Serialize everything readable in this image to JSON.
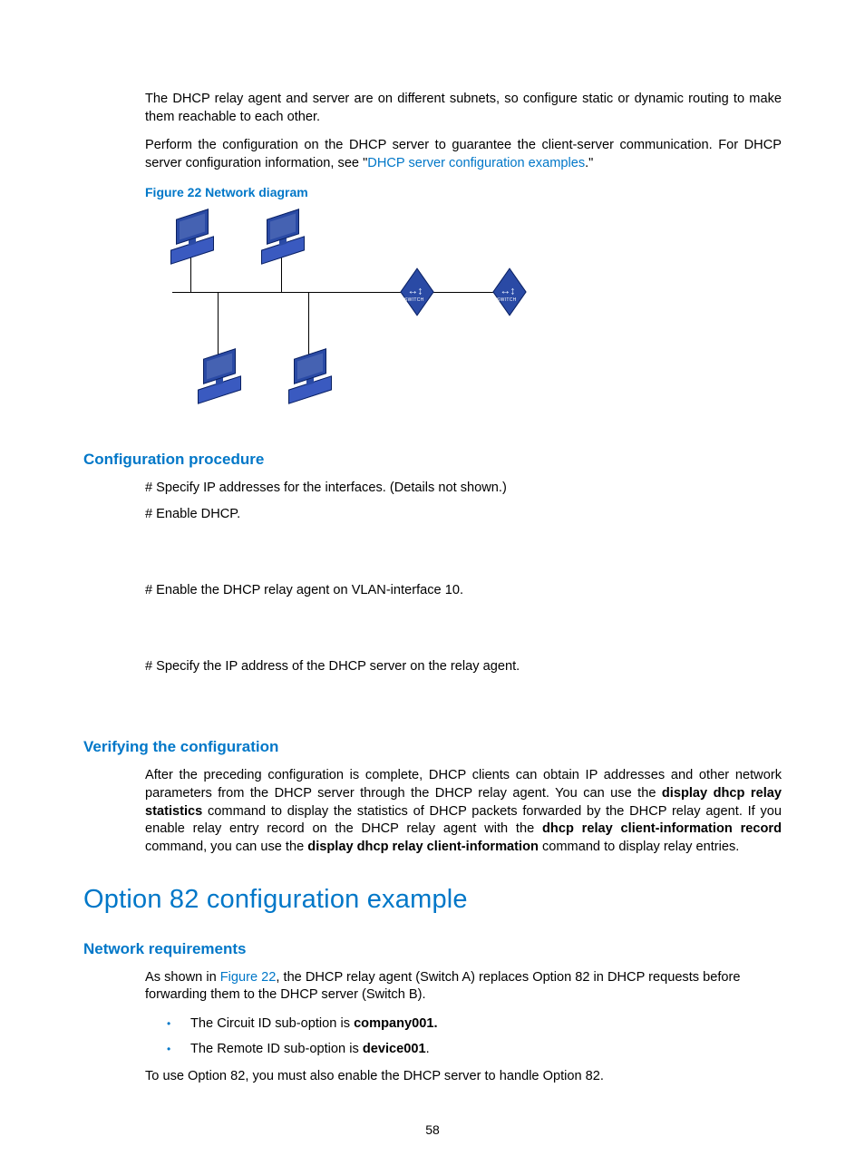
{
  "intro": {
    "p1": "The DHCP relay agent and server are on different subnets, so configure static or dynamic routing to make them reachable to each other.",
    "p2_a": "Perform the configuration on the DHCP server to guarantee the client-server communication. For DHCP server configuration information, see \"",
    "p2_link": "DHCP server configuration examples",
    "p2_b": ".\""
  },
  "figure_caption": "Figure 22 Network diagram",
  "sections": {
    "config_proc": "Configuration procedure",
    "verify": "Verifying the configuration",
    "option82": "Option 82 configuration example",
    "net_req": "Network requirements"
  },
  "steps": {
    "s1": "# Specify IP addresses for the interfaces. (Details not shown.)",
    "s2": "# Enable DHCP.",
    "s3": "# Enable the DHCP relay agent on VLAN-interface 10.",
    "s4": "# Specify the IP address of the DHCP server on the relay agent."
  },
  "verify_para": {
    "a": "After the preceding configuration is complete, DHCP clients can obtain IP addresses and other network parameters from the DHCP server through the DHCP relay agent. You can use the ",
    "b": "display dhcp relay statistics",
    "c": " command to display the statistics of DHCP packets forwarded by the DHCP relay agent. If you enable relay entry record on the DHCP relay agent with the ",
    "d": "dhcp relay client-information record",
    "e": " command, you can use the ",
    "f": "display dhcp relay client-information",
    "g": " command to display relay entries."
  },
  "netreq": {
    "p1_a": "As shown in ",
    "p1_link": "Figure 22",
    "p1_b": ", the DHCP relay agent (Switch A) replaces Option 82 in DHCP requests before forwarding them to the DHCP server (Switch B).",
    "b1_a": "The Circuit ID sub-option is ",
    "b1_b": "company001.",
    "b2_a": "The Remote ID sub-option is ",
    "b2_b": "device001",
    "b2_c": ".",
    "p2": "To use Option 82, you must also enable the DHCP server to handle Option 82."
  },
  "page_number": "58"
}
